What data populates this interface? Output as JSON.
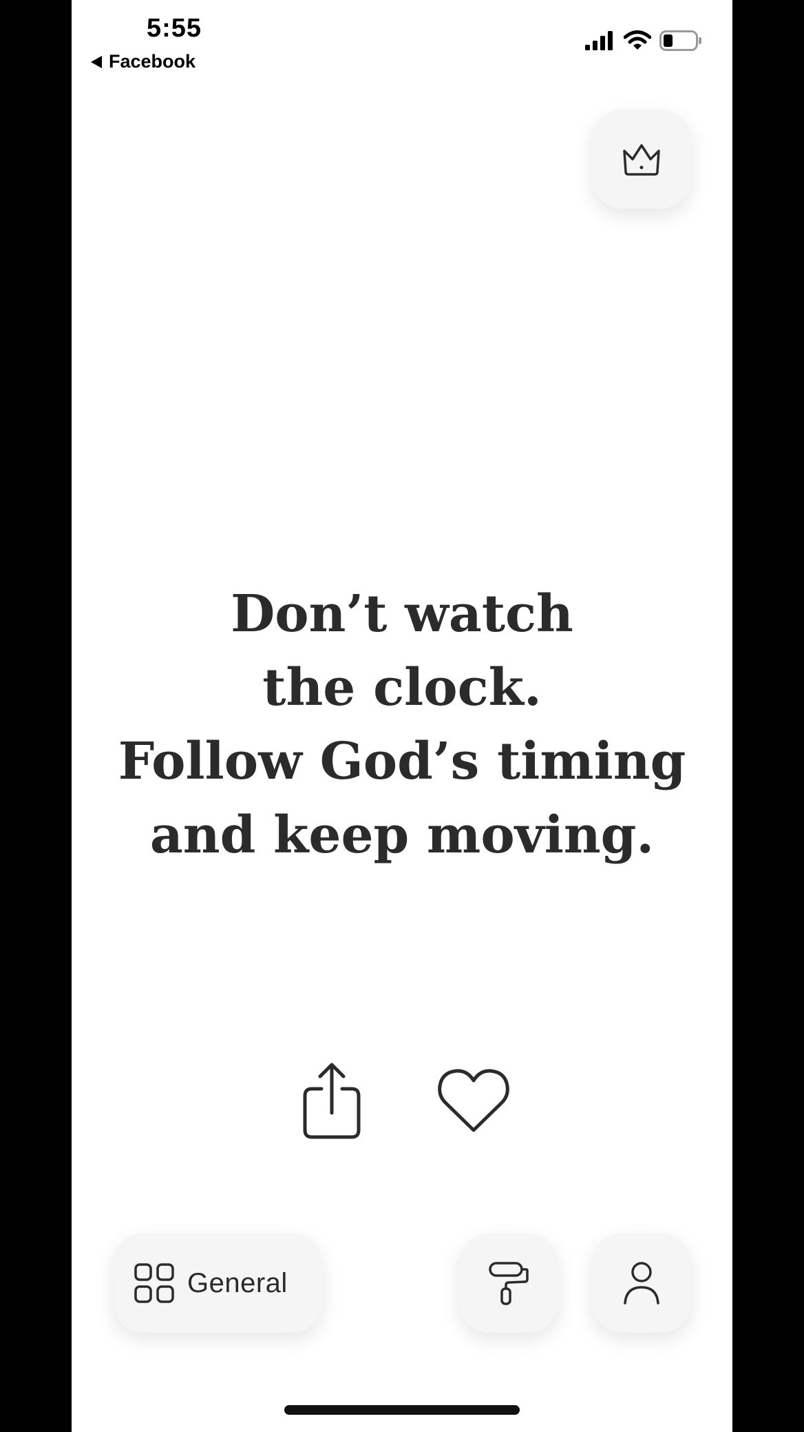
{
  "status_bar": {
    "time": "5:55",
    "back_app": "Facebook",
    "icons": [
      "cellular-signal-icon",
      "wifi-icon",
      "battery-icon"
    ]
  },
  "quote": {
    "lines": [
      "Don’t watch",
      "the clock.",
      "Follow God’s timing",
      "and keep moving."
    ]
  },
  "actions": {
    "premium_icon": "crown-icon",
    "share_icon": "share-icon",
    "like_icon": "heart-icon"
  },
  "bottom_bar": {
    "category_label": "General",
    "category_icon": "grid-icon",
    "theme_icon": "paint-roller-icon",
    "profile_icon": "person-icon"
  },
  "colors": {
    "text": "#2b2b2b",
    "button_bg": "#f5f5f5",
    "background": "#ffffff"
  }
}
